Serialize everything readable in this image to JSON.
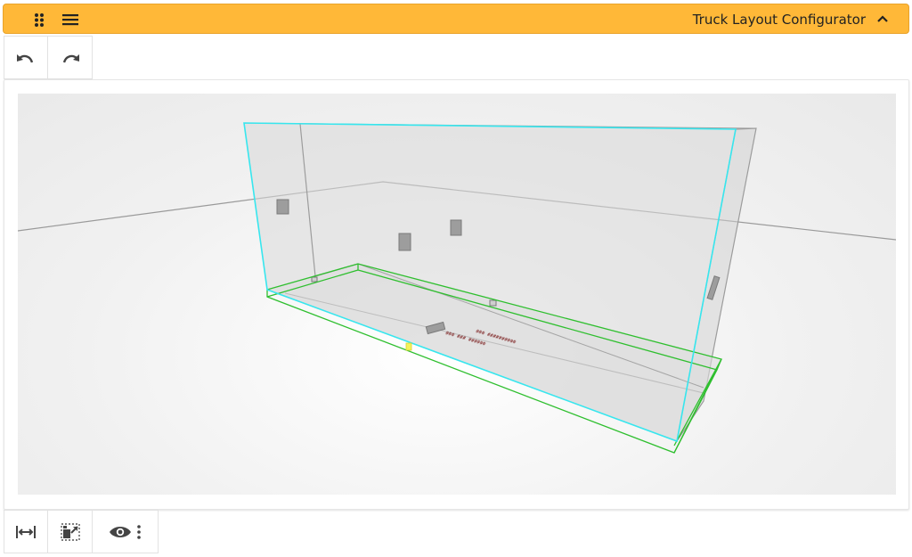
{
  "header": {
    "title": "Truck Layout Configurator",
    "icons": {
      "drag": "drag-dots-icon",
      "menu": "hamburger-menu-icon",
      "collapse": "chevron-up-icon"
    },
    "accent_color": "#ffb838"
  },
  "toolbar_top": {
    "buttons": [
      {
        "name": "undo-button",
        "icon": "undo-icon"
      },
      {
        "name": "redo-button",
        "icon": "redo-icon"
      }
    ]
  },
  "viewport": {
    "floor_labels": [
      "### ### ######",
      "### ##########"
    ],
    "outline_colors": {
      "selection": "#37e6ee",
      "floor": "#2fbf2f"
    }
  },
  "toolbar_bottom": {
    "buttons": [
      {
        "name": "fit-width-button",
        "icon": "fit-width-icon"
      },
      {
        "name": "snap-toggle-button",
        "icon": "snap-grid-icon"
      },
      {
        "name": "visibility-menu-button",
        "icon": "eye-icon"
      }
    ]
  }
}
